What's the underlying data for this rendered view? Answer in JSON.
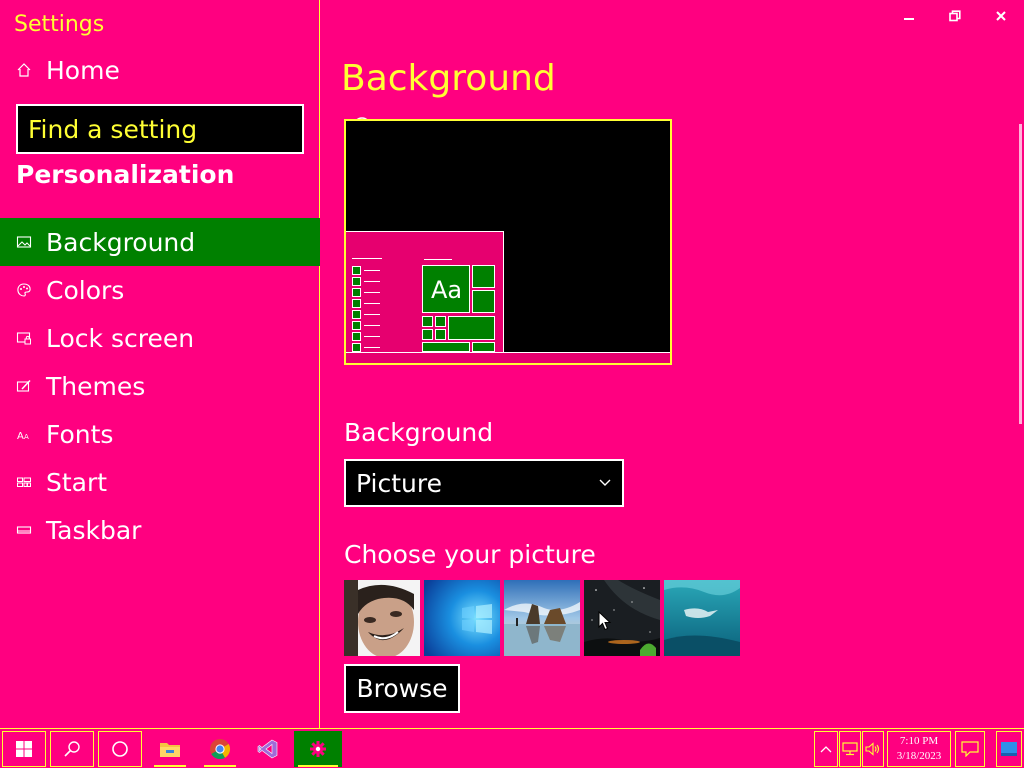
{
  "window": {
    "title": "Settings"
  },
  "sidebar": {
    "home_label": "Home",
    "search_placeholder": "Find a setting",
    "section_heading": "Personalization",
    "items": [
      {
        "label": "Background",
        "icon": "picture-icon",
        "active": true
      },
      {
        "label": "Colors",
        "icon": "palette-icon",
        "active": false
      },
      {
        "label": "Lock screen",
        "icon": "lock-screen-icon",
        "active": false
      },
      {
        "label": "Themes",
        "icon": "themes-icon",
        "active": false
      },
      {
        "label": "Fonts",
        "icon": "fonts-icon",
        "active": false
      },
      {
        "label": "Start",
        "icon": "start-icon",
        "active": false
      },
      {
        "label": "Taskbar",
        "icon": "taskbar-icon",
        "active": false
      }
    ]
  },
  "main": {
    "page_title": "Background",
    "preview": {
      "tile_text": "Aa"
    },
    "background_label": "Background",
    "background_value": "Picture",
    "choose_picture_label": "Choose your picture",
    "thumbnails": [
      "portrait-photo",
      "windows-blue-wallpaper",
      "beach-rocks-wallpaper",
      "night-sky-wallpaper",
      "underwater-swimmer-wallpaper"
    ],
    "browse_label": "Browse"
  },
  "taskbar": {
    "apps": [
      "start-icon",
      "search-icon",
      "cortana-icon",
      "file-explorer-icon",
      "chrome-icon",
      "visual-studio-icon",
      "settings-icon"
    ],
    "clock_time": "7:10 PM",
    "clock_date": "3/18/2023"
  },
  "colors": {
    "background": "#ff0080",
    "accent_text": "#ffff33",
    "selected": "#008000",
    "control_fill": "#000000"
  }
}
